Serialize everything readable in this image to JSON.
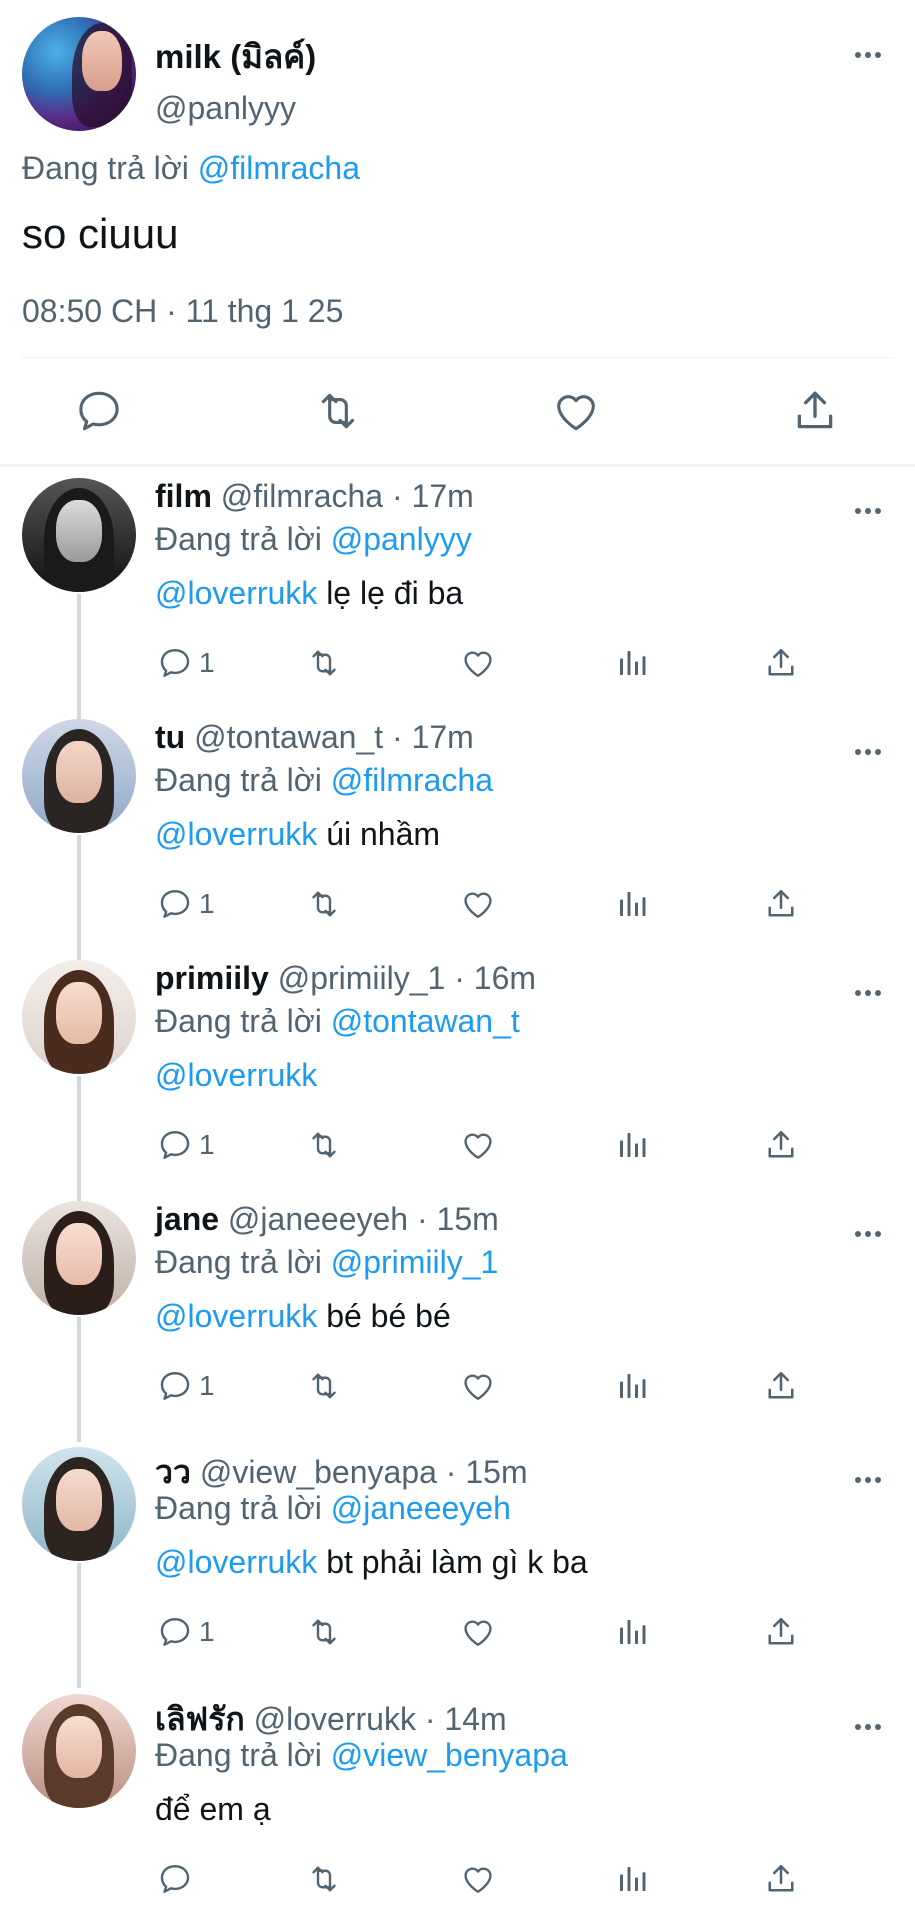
{
  "main_tweet": {
    "name": "milk (มิลค์)",
    "handle": "@panlyyy",
    "replying_label": "Đang trả lời",
    "replying_to": "@filmracha",
    "text": "so ciuuu",
    "timestamp": "08:50 CH · 11 thg 1 25",
    "actions": [
      "reply-icon",
      "retweet-icon",
      "like-icon",
      "share-icon"
    ]
  },
  "replies": [
    {
      "name": "film",
      "handle": "@filmracha",
      "time_sep": " · ",
      "time": "17m",
      "replying_label": "Đang trả lời",
      "replying_to": "@panlyyy",
      "mention": "@loverrukk",
      "text": " lẹ lẹ đi ba",
      "reply_count": "1"
    },
    {
      "name": "tu",
      "handle": "@tontawan_t",
      "time_sep": " · ",
      "time": "17m",
      "replying_label": "Đang trả lời",
      "replying_to": "@filmracha",
      "mention": "@loverrukk",
      "text": " úi nhầm",
      "reply_count": "1"
    },
    {
      "name": "primiily",
      "handle": "@primiily_1",
      "time_sep": " · ",
      "time": "16m",
      "replying_label": "Đang trả lời",
      "replying_to": "@tontawan_t",
      "mention": "@loverrukk",
      "text": "",
      "reply_count": "1"
    },
    {
      "name": "jane",
      "handle": "@janeeeyeh",
      "time_sep": " · ",
      "time": "15m",
      "replying_label": "Đang trả lời",
      "replying_to": "@primiily_1",
      "mention": "@loverrukk",
      "text": " bé bé bé",
      "reply_count": "1"
    },
    {
      "name": "วว",
      "handle": "@view_benyapa",
      "time_sep": " · ",
      "time": "15m",
      "replying_label": "Đang trả lời",
      "replying_to": "@janeeeyeh",
      "mention": "@loverrukk",
      "text": " bt phải làm gì k ba",
      "reply_count": "1"
    },
    {
      "name": "เลิฟรัก",
      "handle": "@loverrukk",
      "time_sep": " · ",
      "time": "14m",
      "replying_label": "Đang trả lời",
      "replying_to": "@view_benyapa",
      "mention": "",
      "text": "để em ạ",
      "reply_count": ""
    }
  ],
  "colors": {
    "link": "#1d9bf0",
    "muted": "#536471",
    "text": "#0f1419",
    "divider": "#eff3f4",
    "thread_line": "#cfd9de"
  }
}
